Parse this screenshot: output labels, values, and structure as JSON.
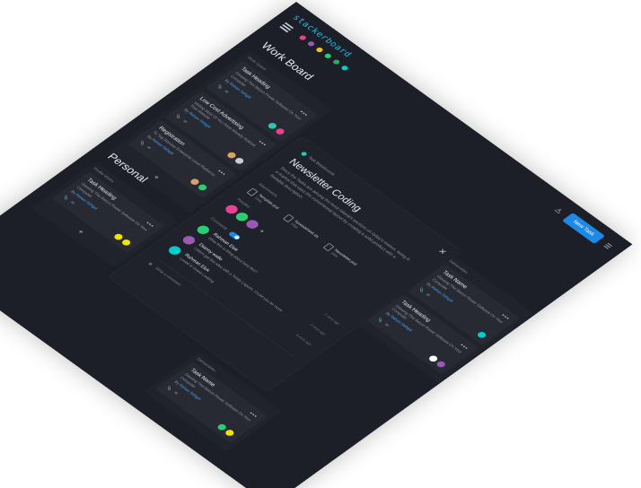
{
  "app": {
    "logo": "stackerboard"
  },
  "tab_colors": [
    "#e84393",
    "#9b59b6",
    "#f1c40f",
    "#2ecc71",
    "#27ae60",
    "#00cec9"
  ],
  "header": {
    "new_task_label": "New Task"
  },
  "work_board": {
    "title": "Work Board",
    "columns": [
      {
        "label": "Work Space",
        "cards": [
          {
            "title": "Task Heading",
            "desc": "Glowing This Bacon Power Software On Your Computer",
            "by": "By",
            "author": "Rehan Sehgal",
            "avatars": [
              "#2ec4b6",
              "#e84393"
            ]
          },
          {
            "title": "Low Cost Advertising",
            "desc": "Writing Most Of You Have Already Noticed That Website",
            "by": "By",
            "author": "Rehan Sehgal",
            "avatars": [
              "#e0a060",
              "#c9ccd6"
            ]
          },
          {
            "title": "Registration",
            "desc": "To Tag Stanzas Enterprise Level Platforms",
            "by": "By",
            "author": "Rehan Sehgal",
            "avatars": [
              "#d8a070",
              "#2ecc71"
            ]
          }
        ],
        "add": "+"
      }
    ]
  },
  "personal": {
    "title": "Personal",
    "columns": [
      {
        "label": "Profile Works",
        "cards": [
          {
            "title": "Task Heading",
            "desc": "Glowing This Bacon Power Software On Your Computer",
            "by": "By",
            "author": "Rehan Sehgal",
            "avatars": [
              "#f1e500",
              "#f1e500"
            ]
          }
        ],
        "add": "+"
      }
    ]
  },
  "modal": {
    "breadcrumb": "Task Breadcrumb",
    "title": "Newsletter Coding",
    "desc": "Since the Tasks are among the most relevant sections on today's market, being in a market that uses the conventional layout by creating a solid product with a Reliable description.",
    "attachments_label": "Attachments",
    "attachments": [
      {
        "name": "Template.psd",
        "size": "24kb"
      },
      {
        "name": "Spreadsheet.xls",
        "size": "24kb"
      },
      {
        "name": "Newsletter.psd",
        "size": "24kb"
      }
    ],
    "people_label": "Peoples",
    "people": [
      "#e84393",
      "#2ecc71",
      "#9b59b6"
    ],
    "comments_label": "Comments",
    "comments": [
      {
        "name": "Rahman Elok",
        "text": "What this is thing about best this?",
        "time": "2 mins ago",
        "color": "#2ecc71"
      },
      {
        "name": "Dianny wallo",
        "text": "I didn't get this idea with a Trinity Lagoon, Could you be more",
        "time": "5 mins ago",
        "color": "#9b59b6"
      },
      {
        "name": "Rahman Elok",
        "text": "Loved it! Great Looking",
        "time": "8 mins ago",
        "color": "#00cec9"
      }
    ],
    "write_placeholder": "Write a comment"
  },
  "right_columns": [
    {
      "label": "Deliverables",
      "cards": [
        {
          "title": "Task Name",
          "desc": "Glowing This Bacon Power Software On Your Computer",
          "by": "By",
          "author": "Rehan Sehgal",
          "avatars": [
            "#00cec9"
          ]
        },
        {
          "title": "Task Heading",
          "desc": "Glowing This Bacon Power Software On Your Computer",
          "by": "By",
          "author": "Rehan Sehgal",
          "avatars": [
            "#ffffff",
            "#9b59b6"
          ]
        }
      ]
    },
    {
      "label": "Deliverables",
      "cards": [
        {
          "title": "Task Name",
          "desc": "Glowing This Bacon Power Software On Your Computer",
          "by": "By",
          "author": "Rehan Sehgal",
          "avatars": [
            "#2ecc71",
            "#f1e500"
          ]
        }
      ]
    }
  ]
}
